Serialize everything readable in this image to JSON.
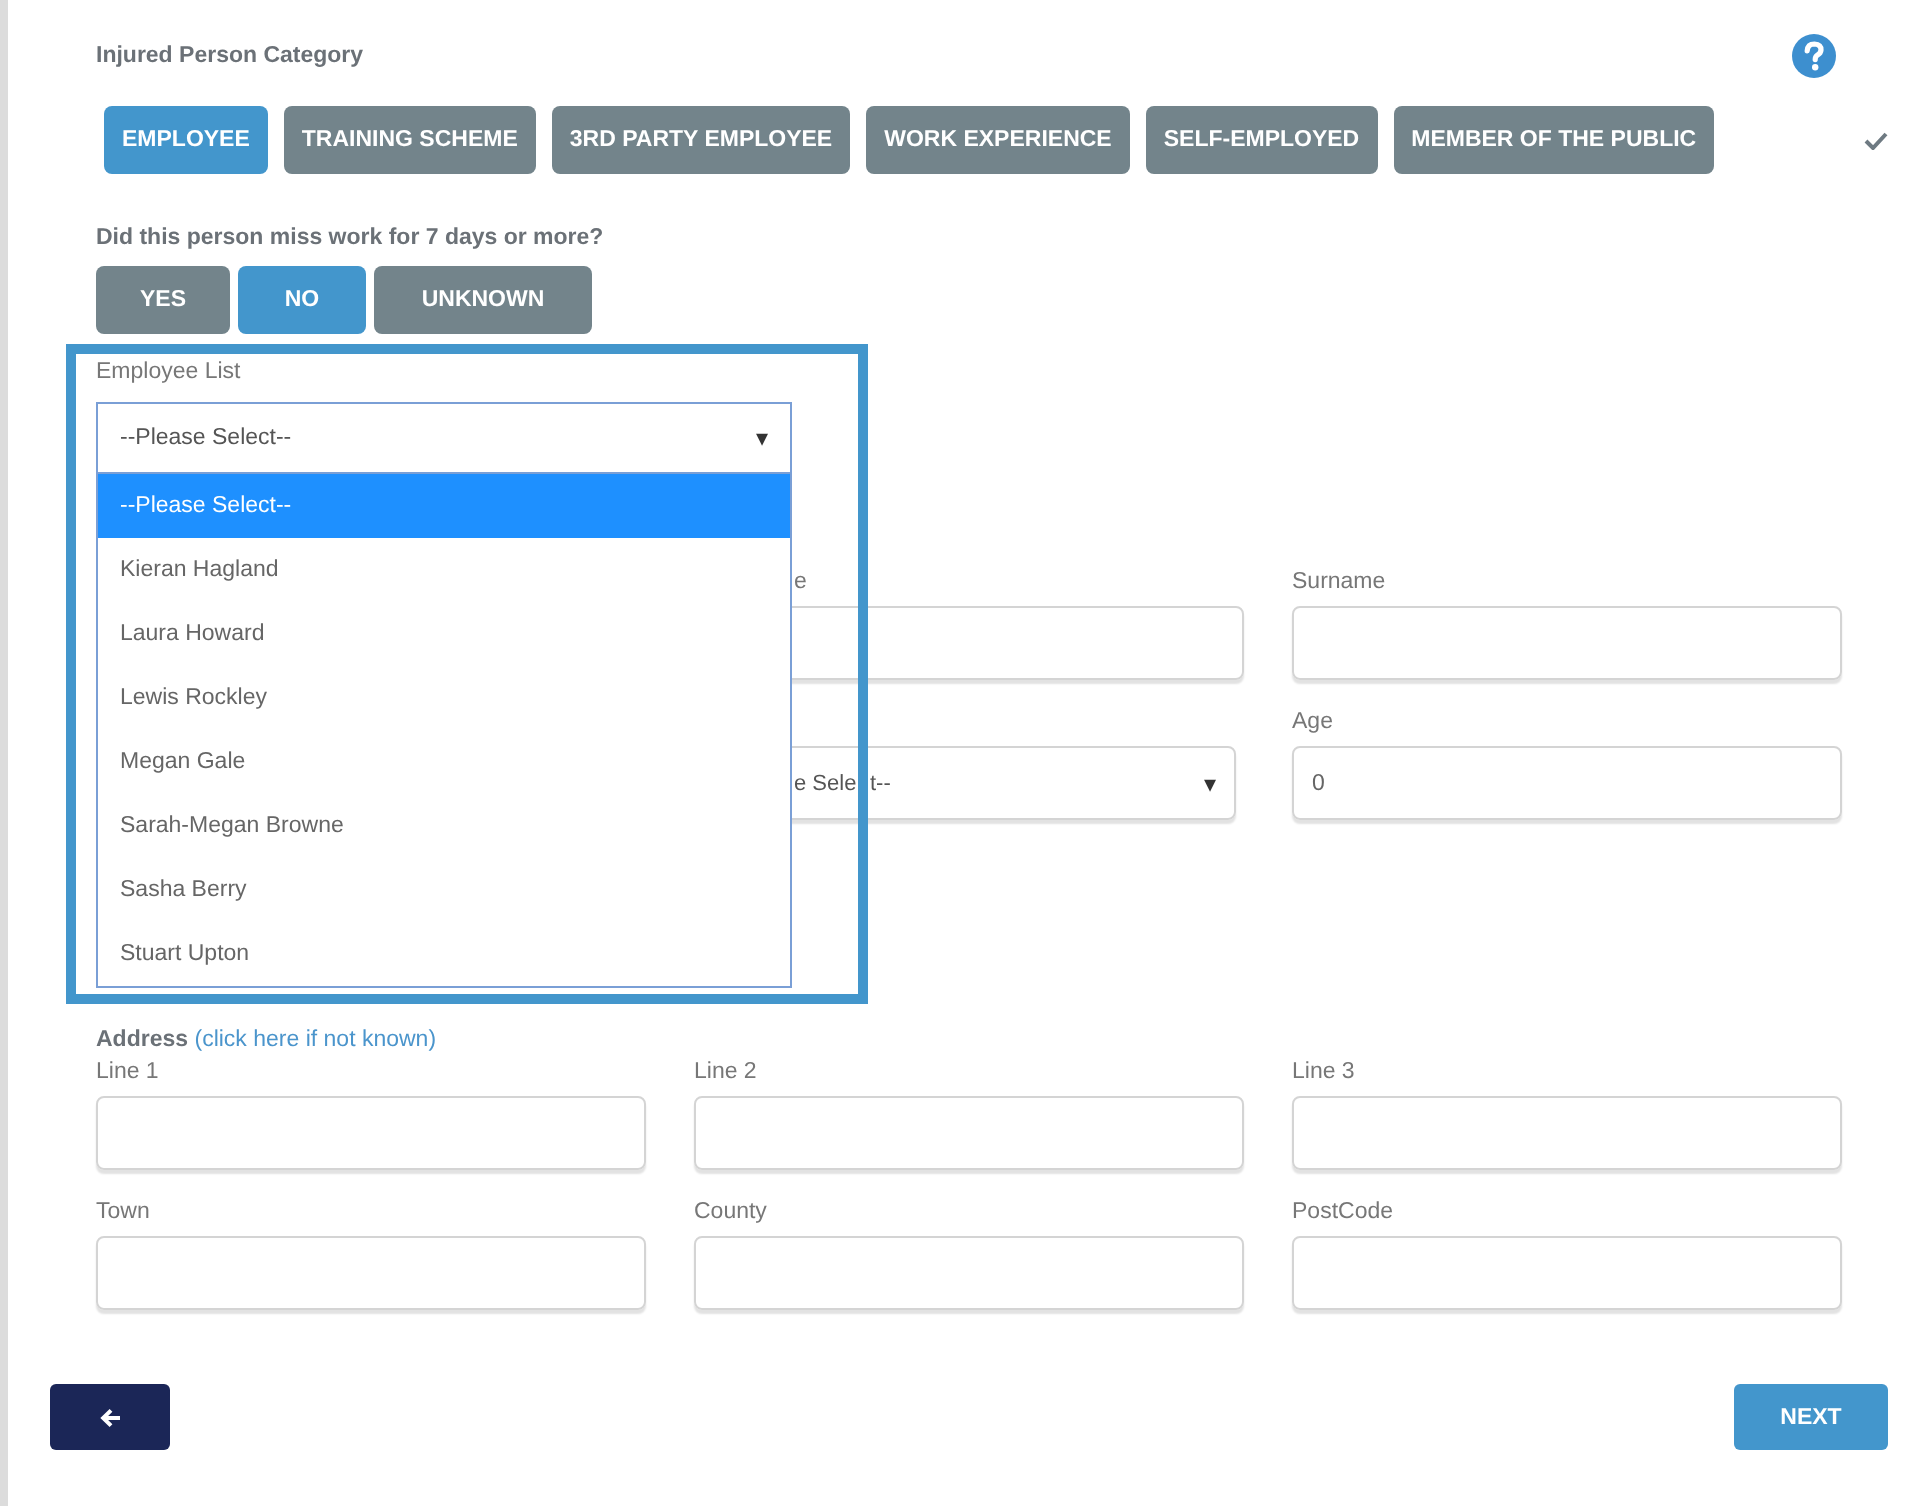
{
  "category": {
    "label": "Injured Person Category",
    "complete": true,
    "options": [
      {
        "label": "EMPLOYEE",
        "selected": true
      },
      {
        "label": "TRAINING SCHEME",
        "selected": false
      },
      {
        "label": "3RD PARTY EMPLOYEE",
        "selected": false
      },
      {
        "label": "WORK EXPERIENCE",
        "selected": false
      },
      {
        "label": "SELF-EMPLOYED",
        "selected": false
      },
      {
        "label": "MEMBER OF THE PUBLIC",
        "selected": false
      }
    ]
  },
  "missed_work": {
    "question": "Did this person miss work for 7 days or more?",
    "options": [
      {
        "label": "YES",
        "selected": false
      },
      {
        "label": "NO",
        "selected": true
      },
      {
        "label": "UNKNOWN",
        "selected": false
      }
    ]
  },
  "employee_list": {
    "label": "Employee List",
    "value": "--Please Select--",
    "arrow": "▾",
    "expanded": true,
    "options": [
      {
        "label": "--Please Select--",
        "selected": true
      },
      {
        "label": "Kieran Hagland",
        "selected": false
      },
      {
        "label": "Laura Howard",
        "selected": false
      },
      {
        "label": "Lewis Rockley",
        "selected": false
      },
      {
        "label": "Megan Gale",
        "selected": false
      },
      {
        "label": "Sarah-Megan Browne",
        "selected": false
      },
      {
        "label": "Sasha Berry",
        "selected": false
      },
      {
        "label": "Stuart Upton",
        "selected": false
      }
    ]
  },
  "person_fields": [
    {
      "kind": "input",
      "label": "e"
    },
    {
      "kind": "input",
      "label": "Surname"
    },
    {
      "kind": "select",
      "value_parts": [
        "e Sele",
        "t--"
      ],
      "arrow": "▾"
    },
    {
      "kind": "input",
      "label": "Age",
      "value": "0"
    }
  ],
  "address": {
    "label": "Address",
    "link": "(click here if not known)",
    "fields": [
      {
        "label": "Line 1"
      },
      {
        "label": "Line 2"
      },
      {
        "label": "Line 3"
      },
      {
        "label": "Town"
      },
      {
        "label": "County"
      },
      {
        "label": "PostCode"
      }
    ]
  },
  "buttons": [
    {
      "kind": "back"
    },
    {
      "kind": "next",
      "label": "NEXT"
    }
  ]
}
